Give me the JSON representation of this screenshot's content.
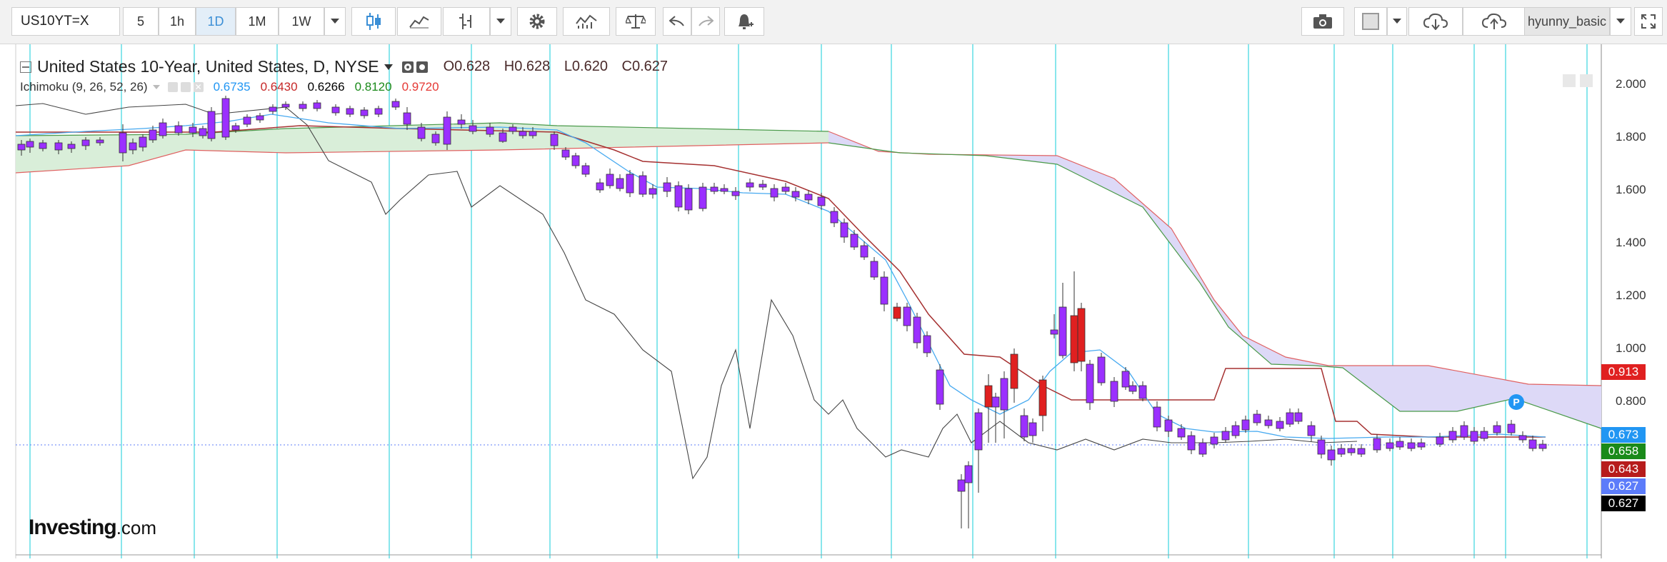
{
  "toolbar": {
    "symbol": "US10YT=X",
    "intervals": [
      "5",
      "1h",
      "1D",
      "1M",
      "1W"
    ],
    "active_interval": "1D",
    "user": "hyunny_basic"
  },
  "legend": {
    "title": "United States 10-Year, United States, D, NYSE",
    "open": "O0.628",
    "high": "H0.628",
    "low": "L0.620",
    "close": "C0.627",
    "indicator": "Ichimoku (9, 26, 52, 26)",
    "ichimoku_values": [
      {
        "text": "0.6735",
        "color": "#2196f3"
      },
      {
        "text": "0.6430",
        "color": "#c62828"
      },
      {
        "text": "0.6266",
        "color": "#000000"
      },
      {
        "text": "0.8120",
        "color": "#1b8a1b"
      },
      {
        "text": "0.9720",
        "color": "#e53935"
      }
    ]
  },
  "price_axis": {
    "ticks": [
      "2.000",
      "1.800",
      "1.600",
      "1.400",
      "1.200",
      "1.000",
      "0.800"
    ],
    "labels": [
      {
        "text": "0.913",
        "bg": "#e02020",
        "color": "#ffffff"
      },
      {
        "text": "0.673",
        "bg": "#2196f3",
        "color": "#ffffff"
      },
      {
        "text": "0.658",
        "bg": "#1a8a1a",
        "color": "#ffffff"
      },
      {
        "text": "0.643",
        "bg": "#b71c1c",
        "color": "#ffffff"
      },
      {
        "text": "0.627",
        "bg": "#5c7cfa",
        "color": "#ffffff"
      },
      {
        "text": "0.627",
        "bg": "#000000",
        "color": "#ffffff"
      }
    ]
  },
  "marker": {
    "text": "P"
  },
  "logo": {
    "brand": "Investing",
    "suffix": ".com"
  },
  "colors": {
    "up": "#e02020",
    "down": "#9b30ff",
    "cloud": "#d9d6f5",
    "tenkan": "#46a9f0",
    "kijun": "#b03030",
    "chikou": "#333333",
    "grid": "#39d6e0"
  }
}
